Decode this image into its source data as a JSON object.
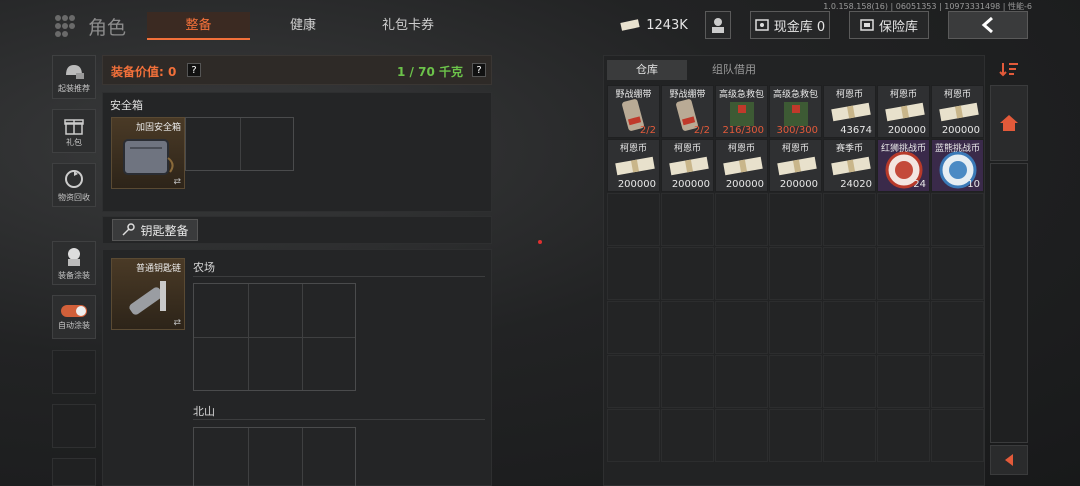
{
  "version": "1.0.158.158(16) | 06051353 | 10973331498 | 性能-6",
  "header": {
    "title": "角色",
    "tabs": [
      "整备",
      "健康",
      "礼包卡券"
    ],
    "currency": "1243K",
    "cash_label": "现金库 0",
    "safe_label": "保险库"
  },
  "sidebar": {
    "items": [
      {
        "label": "起装推荐",
        "icon": "gear-helmet-icon"
      },
      {
        "label": "礼包",
        "icon": "gift-icon"
      },
      {
        "label": "物资回收",
        "icon": "recycle-icon"
      },
      {
        "label": "装备涂装",
        "icon": "skin-icon"
      },
      {
        "label": "自动涂装",
        "icon": "toggle-icon"
      }
    ]
  },
  "equip": {
    "value_label": "装备价值: 0",
    "weight": "1 / 70 千克",
    "help": "?"
  },
  "safebox": {
    "title": "安全箱",
    "item": "加固安全箱"
  },
  "keys": {
    "button": "钥匙整备",
    "item": "普通钥匙链",
    "zones": [
      "农场",
      "北山"
    ]
  },
  "warehouse": {
    "tabs": [
      "仓库",
      "组队借用"
    ],
    "items": [
      {
        "name": "野战绷带",
        "count": "2/2",
        "red": true
      },
      {
        "name": "野战绷带",
        "count": "2/2",
        "red": true
      },
      {
        "name": "高级急救包",
        "count": "216/300",
        "red": true
      },
      {
        "name": "高级急救包",
        "count": "300/300",
        "red": true
      },
      {
        "name": "柯恩币",
        "count": "43674",
        "red": false
      },
      {
        "name": "柯恩币",
        "count": "200000",
        "red": false
      },
      {
        "name": "柯恩币",
        "count": "200000",
        "red": false
      },
      {
        "name": "柯恩币",
        "count": "200000",
        "red": false
      },
      {
        "name": "柯恩币",
        "count": "200000",
        "red": false
      },
      {
        "name": "柯恩币",
        "count": "200000",
        "red": false
      },
      {
        "name": "柯恩币",
        "count": "200000",
        "red": false
      },
      {
        "name": "赛季币",
        "count": "24020",
        "red": false
      },
      {
        "name": "红狮挑战币",
        "count": "24",
        "red": false
      },
      {
        "name": "蓝熊挑战币",
        "count": "10",
        "red": false
      }
    ]
  },
  "colors": {
    "accent": "#f2703a",
    "green": "#6cc34a",
    "panel": "#242526"
  }
}
